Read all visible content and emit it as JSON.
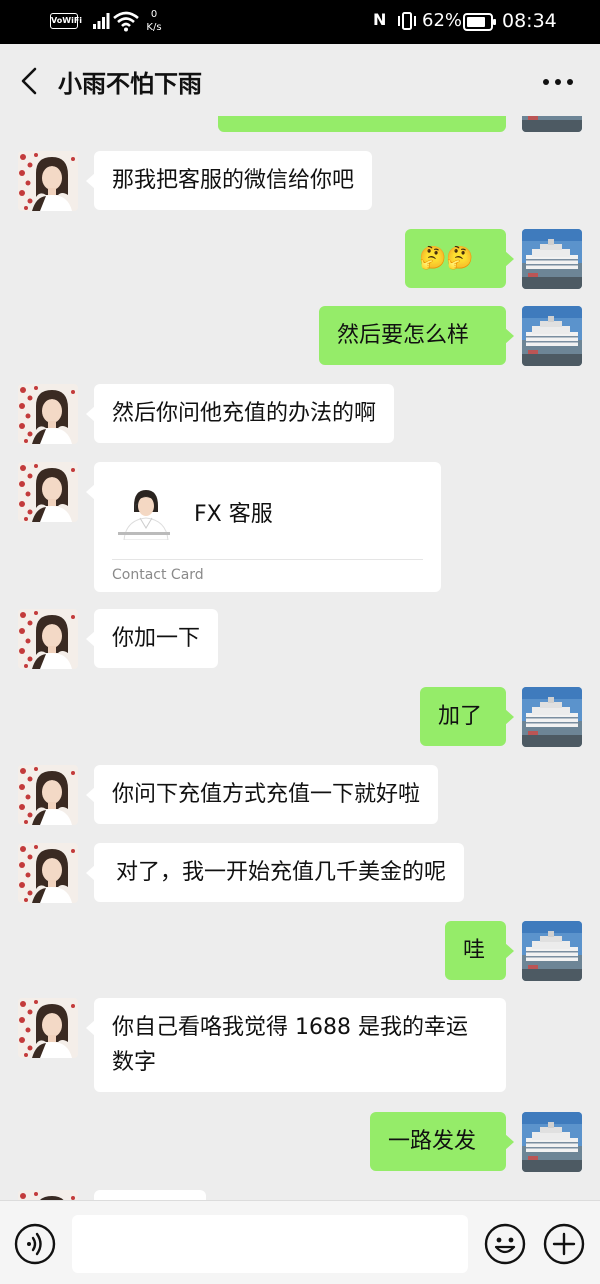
{
  "status_bar": {
    "vowifi": "VoWiFi",
    "speed_value": "0",
    "speed_unit": "K/s",
    "battery_pct": "62%",
    "time": "08:34"
  },
  "header": {
    "title": "小雨不怕下雨"
  },
  "messages": [
    {
      "side": "in",
      "text": "那我把客服的微信给你吧"
    },
    {
      "side": "out",
      "text": "🤔🤔"
    },
    {
      "side": "out",
      "text": "然后要怎么样"
    },
    {
      "side": "in",
      "text": "然后你问他充值的办法的啊"
    },
    {
      "side": "in",
      "type": "contact_card",
      "name": "FX 客服",
      "label": "Contact Card"
    },
    {
      "side": "in",
      "text": "你加一下"
    },
    {
      "side": "out",
      "text": "加了"
    },
    {
      "side": "in",
      "text": "你问下充值方式充值一下就好啦"
    },
    {
      "side": "in",
      "text": "对了，我一开始充值几千美金的呢"
    },
    {
      "side": "out",
      "text": "哇"
    },
    {
      "side": "in",
      "text": "你自己看咯我觉得 1688 是我的幸运数字"
    },
    {
      "side": "out",
      "text": "一路发发"
    }
  ],
  "input": {
    "placeholder": ""
  },
  "colors": {
    "outgoing_bubble": "#95ec69",
    "incoming_bubble": "#ffffff",
    "background": "#ededed"
  }
}
